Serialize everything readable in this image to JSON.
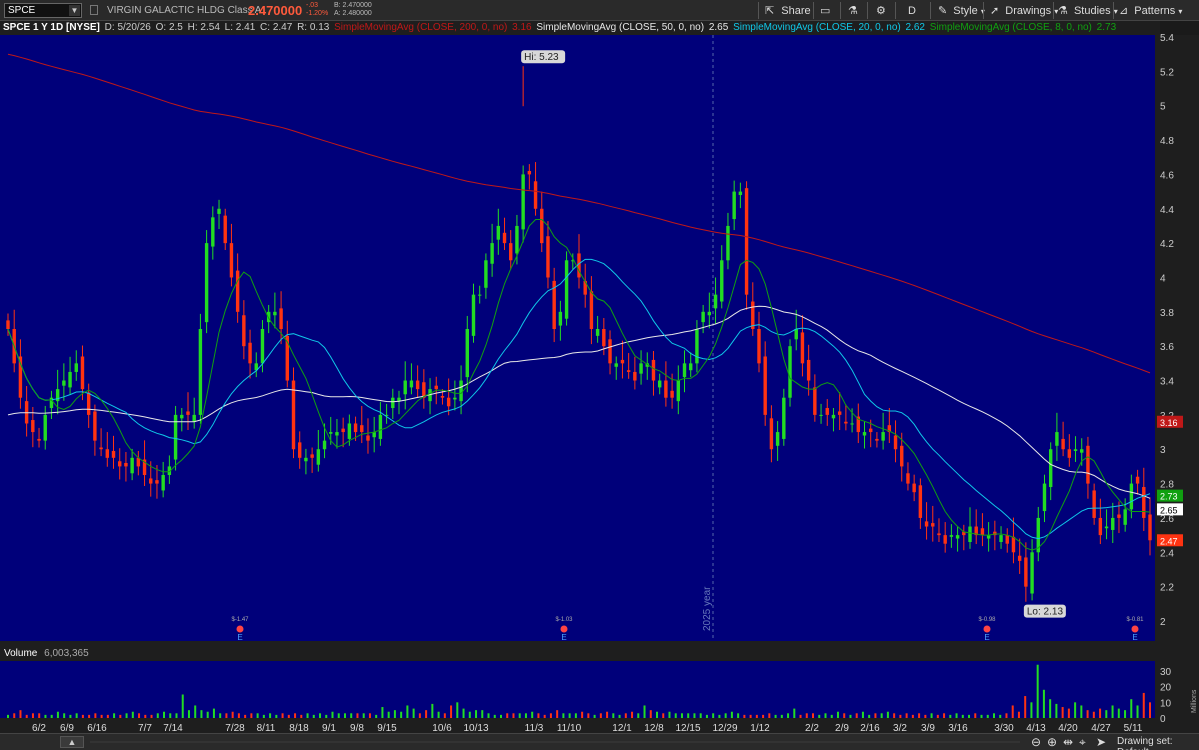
{
  "toolbar": {
    "symbol": "SPCE",
    "company": "VIRGIN GALACTIC HLDG Class A",
    "last": "2.470000",
    "change_abs": "-.03",
    "change_pct": "-1.20%",
    "bid": "B: 2.470000",
    "ask": "A: 2.480000",
    "share": "Share",
    "period": "D",
    "style": "Style",
    "drawings": "Drawings",
    "studies": "Studies",
    "patterns": "Patterns"
  },
  "header": {
    "title": "SPCE 1 Y 1D [NYSE]",
    "date": "D: 5/20/26",
    "open": "O: 2.5",
    "high": "H: 2.54",
    "low": "L: 2.41",
    "close": "C: 2.47",
    "range": "R: 0.13",
    "sma200_label": "SimpleMovingAvg (CLOSE, 200, 0, no)",
    "sma200_value": "3.16",
    "sma50_label": "SimpleMovingAvg (CLOSE, 50, 0, no)",
    "sma50_value": "2.65",
    "sma20_label": "SimpleMovingAvg (CLOSE, 20, 0, no)",
    "sma20_value": "2.62",
    "sma8_label": "SimpleMovingAvg (CLOSE, 8, 0, no)",
    "sma8_value": "2.73"
  },
  "volume": {
    "label": "Volume",
    "value": "6,003,365",
    "axis_unit": "Millions"
  },
  "bottom": {
    "drawing_set": "Drawing set: Default"
  },
  "colors": {
    "background": "#00007a",
    "up": "#22dd22",
    "down": "#ff3311",
    "sma200": "#c01818",
    "sma50": "#e8e8e8",
    "sma20": "#10c8e8",
    "sma8": "#10a010"
  },
  "chart_data": {
    "type": "candlestick",
    "price_axis": {
      "min": 2.0,
      "max": 5.4,
      "ticks": [
        "5.4",
        "5.2",
        "5",
        "4.8",
        "4.6",
        "4.4",
        "4.2",
        "4",
        "3.8",
        "3.6",
        "3.4",
        "3.2",
        "3",
        "2.8",
        "2.6",
        "2.4",
        "2.2",
        "2"
      ]
    },
    "x_labels": [
      "6/2",
      "6/9",
      "6/16",
      "7/7",
      "7/14",
      "7/28",
      "8/11",
      "8/18",
      "9/1",
      "9/8",
      "9/15",
      "10/6",
      "10/13",
      "11/3",
      "11/10",
      "12/1",
      "12/8",
      "12/15",
      "12/29",
      "1/12",
      "2/2",
      "2/9",
      "2/16",
      "3/2",
      "3/9",
      "3/16",
      "3/30",
      "4/13",
      "4/20",
      "4/27",
      "5/11"
    ],
    "volume_axis": {
      "min": 0,
      "max": 30,
      "ticks": [
        "30",
        "20",
        "10",
        "0"
      ]
    },
    "hi_label": "Hi: 5.23",
    "lo_label": "Lo: 2.13",
    "year_marker": "2025 year",
    "markers": [
      {
        "date": "7/14",
        "text": "$-1.47",
        "letter": "E"
      },
      {
        "date": "11/10",
        "text": "$-1.03",
        "letter": "E"
      },
      {
        "date": "3/30",
        "text": "$-0.98",
        "letter": "E"
      },
      {
        "date": "5/11",
        "text": "$-0.81",
        "letter": "E"
      }
    ],
    "price_bubbles": [
      {
        "label": "3.16",
        "color": "#c01818"
      },
      {
        "label": "2.73",
        "color": "#10a010"
      },
      {
        "label": "2.65",
        "color": "#ffffff"
      },
      {
        "label": "2.47",
        "color": "#ff3311"
      }
    ],
    "series_close_approx": [
      3.7,
      3.5,
      3.3,
      3.15,
      3.1,
      3.05,
      3.2,
      3.3,
      3.35,
      3.4,
      3.45,
      3.5,
      3.35,
      3.2,
      3.05,
      3.0,
      2.95,
      2.95,
      2.9,
      2.9,
      2.95,
      2.9,
      2.85,
      2.8,
      2.8,
      2.85,
      2.9,
      3.2,
      3.2,
      3.2,
      3.2,
      3.7,
      4.2,
      4.35,
      4.4,
      4.2,
      4.0,
      3.8,
      3.6,
      3.5,
      3.5,
      3.7,
      3.8,
      3.8,
      3.7,
      3.4,
      3.0,
      2.95,
      2.95,
      2.95,
      3.0,
      3.05,
      3.1,
      3.1,
      3.1,
      3.15,
      3.1,
      3.1,
      3.05,
      3.1,
      3.2,
      3.2,
      3.3,
      3.3,
      3.4,
      3.4,
      3.35,
      3.3,
      3.35,
      3.35,
      3.3,
      3.25,
      3.3,
      3.4,
      3.7,
      3.9,
      3.9,
      4.1,
      4.2,
      4.3,
      4.2,
      4.1,
      4.3,
      4.6,
      4.6,
      4.4,
      4.2,
      4.0,
      3.7,
      3.8,
      4.1,
      4.1,
      4.0,
      3.9,
      3.7,
      3.7,
      3.6,
      3.5,
      3.5,
      3.5,
      3.45,
      3.4,
      3.5,
      3.5,
      3.4,
      3.4,
      3.3,
      3.3,
      3.4,
      3.5,
      3.5,
      3.7,
      3.8,
      3.8,
      3.9,
      4.1,
      4.3,
      4.5,
      4.5,
      3.9,
      3.7,
      3.5,
      3.2,
      3.0,
      3.1,
      3.3,
      3.6,
      3.7,
      3.5,
      3.4,
      3.2,
      3.2,
      3.2,
      3.2,
      3.2,
      3.15,
      3.15,
      3.1,
      3.1,
      3.1,
      3.05,
      3.1,
      3.1,
      3.0,
      2.9,
      2.8,
      2.75,
      2.6,
      2.55,
      2.55,
      2.5,
      2.45,
      2.5,
      2.5,
      2.5,
      2.55,
      2.5,
      2.5,
      2.5,
      2.5,
      2.5,
      2.45,
      2.4,
      2.35,
      2.2,
      2.4,
      2.6,
      2.8,
      3.0,
      3.1,
      3.0,
      2.95,
      3.0,
      3.0,
      2.8,
      2.6,
      2.5,
      2.55,
      2.6,
      2.6,
      2.65,
      2.8,
      2.8,
      2.6,
      2.47
    ],
    "volumes_m": [
      2,
      3,
      5,
      2,
      3,
      3,
      2,
      2,
      4,
      3,
      2,
      3,
      2,
      2,
      3,
      2,
      2,
      3,
      2,
      3,
      4,
      3,
      2,
      2,
      3,
      4,
      3,
      3,
      15,
      5,
      8,
      5,
      4,
      6,
      3,
      3,
      4,
      3,
      2,
      3,
      3,
      2,
      3,
      2,
      3,
      2,
      3,
      2,
      3,
      2,
      3,
      2,
      4,
      3,
      3,
      3,
      3,
      3,
      3,
      2,
      7,
      4,
      5,
      4,
      8,
      6,
      3,
      5,
      9,
      4,
      3,
      8,
      10,
      6,
      4,
      5,
      5,
      3,
      2,
      2,
      3,
      3,
      3,
      3,
      4,
      3,
      2,
      3,
      5,
      3,
      3,
      3,
      4,
      3,
      2,
      3,
      4,
      3,
      2,
      3,
      4,
      3,
      8,
      5,
      4,
      3,
      4,
      3,
      3,
      3,
      3,
      3,
      2,
      3,
      2,
      3,
      4,
      3,
      2,
      2,
      2,
      2,
      3,
      2,
      2,
      3,
      6,
      2,
      3,
      3,
      2,
      3,
      2,
      4,
      3,
      2,
      3,
      4,
      2,
      3,
      3,
      4,
      3,
      2,
      3,
      2,
      3,
      2,
      3,
      2,
      3,
      2,
      3,
      2,
      2,
      3,
      2,
      2,
      3,
      2,
      3,
      8,
      4,
      14,
      10,
      34,
      18,
      12,
      9,
      7,
      6,
      10,
      8,
      5,
      4,
      6,
      5,
      8,
      6,
      5,
      12,
      8,
      16,
      10
    ]
  }
}
